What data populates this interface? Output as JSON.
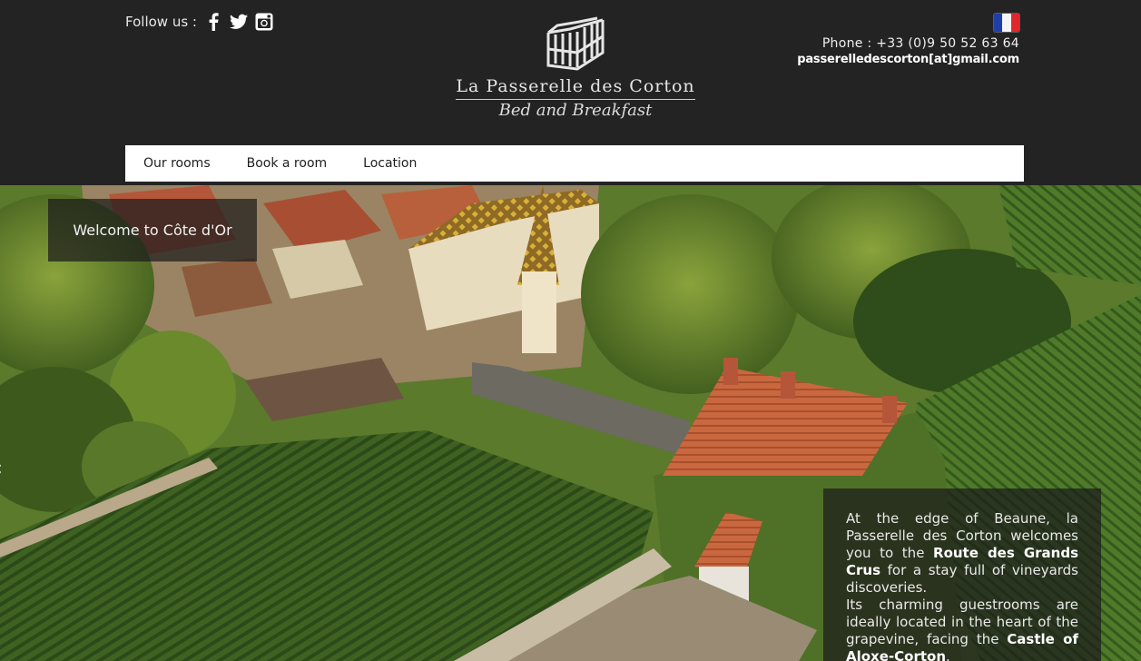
{
  "header": {
    "follow_label": "Follow us :",
    "social": [
      {
        "name": "facebook-icon"
      },
      {
        "name": "twitter-icon"
      },
      {
        "name": "instagram-icon"
      }
    ],
    "language_flag": "fr-flag-icon",
    "phone": "Phone : +33 (0)9 50 52 63 64",
    "email": "passerelledescorton[at]gmail.com",
    "logo_title": "La Passerelle des Corton",
    "logo_subtitle": "Bed and Breakfast"
  },
  "nav": {
    "items": [
      {
        "label": "Our rooms"
      },
      {
        "label": "Book a room"
      },
      {
        "label": "Location"
      }
    ]
  },
  "hero": {
    "welcome_text": "Welcome to Côte d'Or",
    "intro": {
      "p1_a": "At the edge of Beaune, la Passerelle des Corton welcomes you to the ",
      "p1_bold": "Route des Grands Crus",
      "p1_b": " for a stay full of vineyards discoveries.",
      "p2_a": "Its charming guestrooms are ideally located in the heart of the grapevine, facing the ",
      "p2_bold": "Castle of Aloxe-Corton",
      "p2_b": "."
    }
  },
  "colors": {
    "header_bg": "#232323",
    "nav_bg": "#ffffff",
    "overlay": "rgba(28,28,28,0.72)"
  }
}
